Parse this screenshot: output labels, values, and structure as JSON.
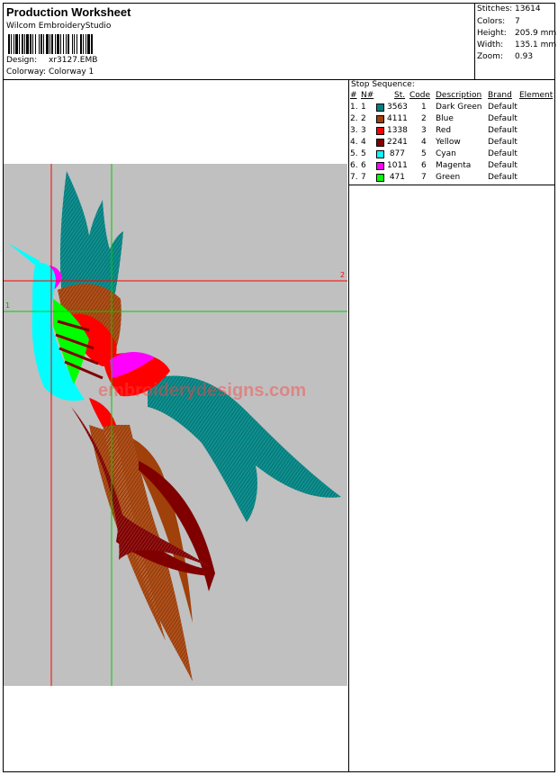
{
  "header": {
    "title": "Production Worksheet",
    "software": "Wilcom EmbroideryStudio",
    "design_label": "Design:",
    "design_value": "xr3127.EMB",
    "colorway_label": "Colorway:",
    "colorway_value": "Colorway 1"
  },
  "stats": [
    {
      "label": "Stitches:",
      "value": "13614"
    },
    {
      "label": "Colors:",
      "value": "7"
    },
    {
      "label": "Height:",
      "value": "205.9 mm"
    },
    {
      "label": "Width:",
      "value": "135.1 mm"
    },
    {
      "label": "Zoom:",
      "value": "0.93"
    }
  ],
  "stop_sequence": {
    "title": "Stop Sequence:",
    "headers": {
      "num": "#",
      "nn": "N#",
      "st": "St.",
      "code": "Code",
      "description": "Description",
      "brand": "Brand",
      "element": "Element"
    },
    "rows": [
      {
        "num": "1.",
        "nn": "1",
        "color": "#008080",
        "st": "3563",
        "code": "1",
        "description": "Dark Green",
        "brand": "Default"
      },
      {
        "num": "2.",
        "nn": "2",
        "color": "#a0400a",
        "st": "4111",
        "code": "2",
        "description": "Blue",
        "brand": "Default"
      },
      {
        "num": "3.",
        "nn": "3",
        "color": "#ff0000",
        "st": "1338",
        "code": "3",
        "description": "Red",
        "brand": "Default"
      },
      {
        "num": "4.",
        "nn": "4",
        "color": "#800000",
        "st": "2241",
        "code": "4",
        "description": "Yellow",
        "brand": "Default"
      },
      {
        "num": "5.",
        "nn": "5",
        "color": "#00ffff",
        "st": "877",
        "code": "5",
        "description": "Cyan",
        "brand": "Default"
      },
      {
        "num": "6.",
        "nn": "6",
        "color": "#ff00ff",
        "st": "1011",
        "code": "6",
        "description": "Magenta",
        "brand": "Default"
      },
      {
        "num": "7.",
        "nn": "7",
        "color": "#00ff00",
        "st": "471",
        "code": "7",
        "description": "Green",
        "brand": "Default"
      }
    ]
  },
  "design_area": {
    "guide_horizontal_red_label": "2",
    "guide_horizontal_green_label": "1",
    "watermark": "embroiderydesigns.com"
  }
}
